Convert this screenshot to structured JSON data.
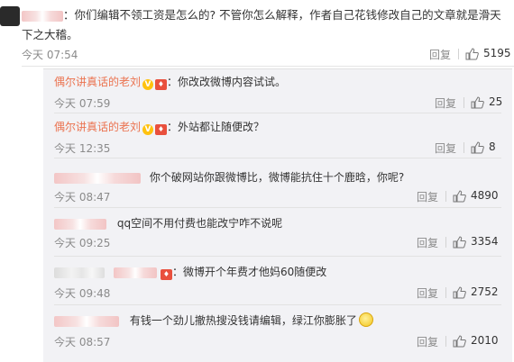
{
  "main_comment": {
    "text": "：你们编辑不领工资是怎么的? 不管你怎么解释，作者自己花钱修改自己的文章就是滑天下之大稽。",
    "time": "今天 07:54",
    "reply_label": "回复",
    "likes": "5195"
  },
  "replies": [
    {
      "user": "偶尔讲真话的老刘",
      "text": "：你改改微博内容试试。",
      "time": "今天 07:59",
      "reply_label": "回复",
      "likes": "25"
    },
    {
      "user": "偶尔讲真话的老刘",
      "text": "：外站都让随便改？",
      "time": "今天 12:35",
      "reply_label": "回复",
      "likes": "8"
    },
    {
      "user": "",
      "text": "你个破网站你跟微博比，微博能抗住十个鹿晗，你呢?",
      "time": "今天 08:47",
      "reply_label": "回复",
      "likes": "4890"
    },
    {
      "user": "",
      "text": "qq空间不用付费也能改宁咋不说呢",
      "time": "今天 09:25",
      "reply_label": "回复",
      "likes": "3354"
    },
    {
      "user": "",
      "text": "：微博开个年费才他妈60随便改",
      "time": "今天 09:48",
      "reply_label": "回复",
      "likes": "2752"
    },
    {
      "user": "",
      "text": "有钱一个劲儿撤热搜没钱请编辑，绿江你膨胀了",
      "time": "今天 08:57",
      "reply_label": "回复",
      "likes": "2010"
    }
  ],
  "icons": {
    "like": "thumbs-up-icon",
    "verified": "verified-badge-icon",
    "vip": "vip-badge-icon",
    "emoji": "smile-emoji-icon"
  },
  "colors": {
    "username": "#eb7350",
    "background": "#f2f2f5",
    "meta": "#8b8b8b"
  }
}
